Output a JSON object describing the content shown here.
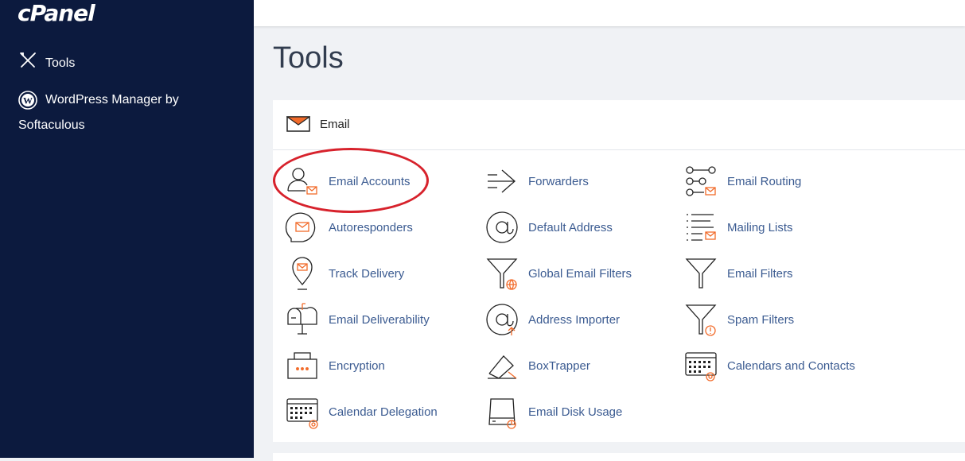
{
  "sidebar": {
    "logo": "cPanel",
    "items": [
      {
        "label": "Tools",
        "icon": "tools-icon"
      },
      {
        "label": "WordPress Manager by Softaculous",
        "icon": "wordpress-icon"
      }
    ]
  },
  "page": {
    "title": "Tools"
  },
  "email_section": {
    "title": "Email",
    "icon": "envelope-icon",
    "tools": [
      {
        "label": "Email Accounts",
        "icon": "email-accounts-icon"
      },
      {
        "label": "Forwarders",
        "icon": "forwarders-icon"
      },
      {
        "label": "Email Routing",
        "icon": "email-routing-icon"
      },
      {
        "label": "Autoresponders",
        "icon": "autoresponders-icon"
      },
      {
        "label": "Default Address",
        "icon": "default-address-icon"
      },
      {
        "label": "Mailing Lists",
        "icon": "mailing-lists-icon"
      },
      {
        "label": "Track Delivery",
        "icon": "track-delivery-icon"
      },
      {
        "label": "Global Email Filters",
        "icon": "global-email-filters-icon"
      },
      {
        "label": "Email Filters",
        "icon": "email-filters-icon"
      },
      {
        "label": "Email Deliverability",
        "icon": "email-deliverability-icon"
      },
      {
        "label": "Address Importer",
        "icon": "address-importer-icon"
      },
      {
        "label": "Spam Filters",
        "icon": "spam-filters-icon"
      },
      {
        "label": "Encryption",
        "icon": "encryption-icon"
      },
      {
        "label": "BoxTrapper",
        "icon": "boxtrapper-icon"
      },
      {
        "label": "Calendars and Contacts",
        "icon": "calendars-contacts-icon"
      },
      {
        "label": "Calendar Delegation",
        "icon": "calendar-delegation-icon"
      },
      {
        "label": "Email Disk Usage",
        "icon": "email-disk-usage-icon"
      }
    ]
  },
  "colors": {
    "sidebar_bg": "#0c1a3e",
    "accent_orange": "#f26b2a",
    "link_blue": "#3b5b91",
    "highlight_red": "#d7222c"
  }
}
